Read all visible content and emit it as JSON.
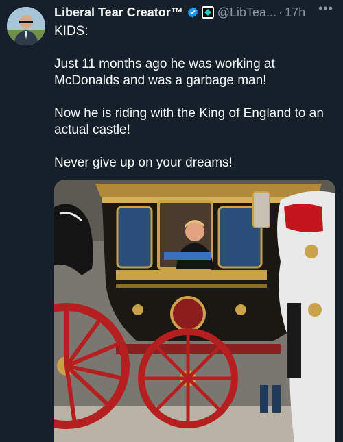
{
  "author": {
    "display_name": "Liberal Tear Creator™",
    "handle": "@LibTea...",
    "separator": "·",
    "time": "17h",
    "verified_icon": "verified-badge-icon",
    "affiliation_icon": "affiliate-badge-icon"
  },
  "tweet": {
    "lines": [
      "KIDS:",
      "Just 11 months ago he was working at McDonalds and was a garbage man!",
      "Now he is riding with the King of England to an actual castle!",
      "Never give up on your dreams!"
    ]
  },
  "more_label": "•••",
  "colors": {
    "background": "#15202b",
    "text": "#f7f9f9",
    "secondary": "#8b98a5",
    "verified": "#1d9bf0",
    "carriage_gold": "#c9a24a",
    "wheel_red": "#b51f1f"
  }
}
